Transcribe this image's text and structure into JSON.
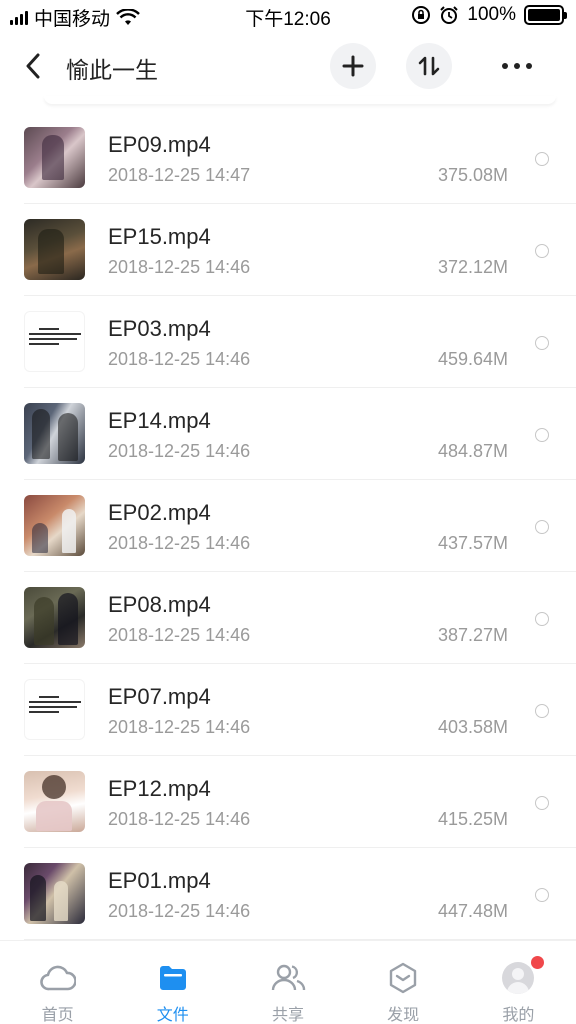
{
  "status_bar": {
    "carrier": "中国移动",
    "time": "下午12:06",
    "battery_percent": "100%",
    "battery_level": 1.0
  },
  "nav": {
    "title": "愉此一生",
    "icons": [
      "back-icon",
      "add-icon",
      "sort-icon",
      "more-icon"
    ]
  },
  "files": [
    {
      "name": "EP09.mp4",
      "date": "2018-12-25 14:47",
      "size": "375.08M",
      "thumb": "t-dark1"
    },
    {
      "name": "EP15.mp4",
      "date": "2018-12-25 14:46",
      "size": "372.12M",
      "thumb": "t-dark2"
    },
    {
      "name": "EP03.mp4",
      "date": "2018-12-25 14:46",
      "size": "459.64M",
      "thumb": "t-white"
    },
    {
      "name": "EP14.mp4",
      "date": "2018-12-25 14:46",
      "size": "484.87M",
      "thumb": "t-dark3"
    },
    {
      "name": "EP02.mp4",
      "date": "2018-12-25 14:46",
      "size": "437.57M",
      "thumb": "t-room"
    },
    {
      "name": "EP08.mp4",
      "date": "2018-12-25 14:46",
      "size": "387.27M",
      "thumb": "t-dark4"
    },
    {
      "name": "EP07.mp4",
      "date": "2018-12-25 14:46",
      "size": "403.58M",
      "thumb": "t-white"
    },
    {
      "name": "EP12.mp4",
      "date": "2018-12-25 14:46",
      "size": "415.25M",
      "thumb": "t-face"
    },
    {
      "name": "EP01.mp4",
      "date": "2018-12-25 14:46",
      "size": "447.48M",
      "thumb": "t-dark5"
    }
  ],
  "tabs": [
    {
      "label": "首页",
      "icon": "cloud-icon",
      "active": false
    },
    {
      "label": "文件",
      "icon": "folder-icon",
      "active": true
    },
    {
      "label": "共享",
      "icon": "people-icon",
      "active": false
    },
    {
      "label": "发现",
      "icon": "discover-icon",
      "active": false
    },
    {
      "label": "我的",
      "icon": "avatar-icon",
      "active": false,
      "badge": true
    }
  ],
  "colors": {
    "accent": "#1e8ff0",
    "tab_inactive": "#9aa0a8",
    "badge": "#f0484b",
    "secondary_text": "#9a9a9a"
  }
}
